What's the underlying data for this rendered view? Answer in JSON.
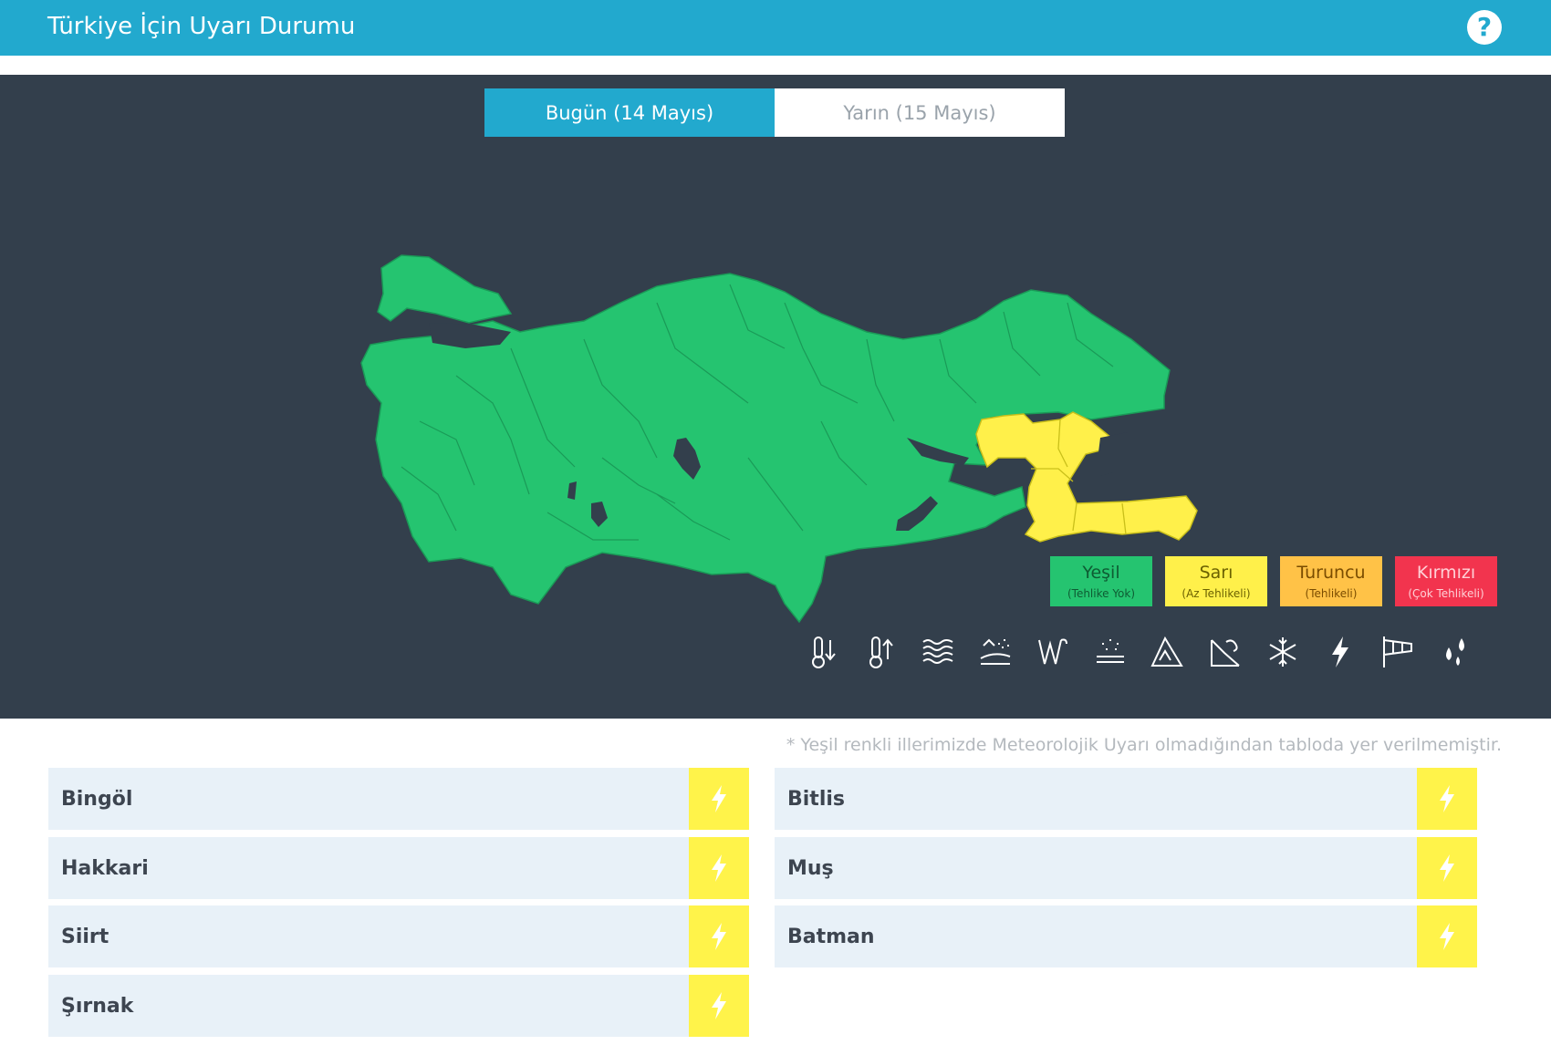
{
  "header": {
    "title": "Türkiye İçin Uyarı Durumu",
    "help_icon": "question-icon"
  },
  "tabs": [
    {
      "label": "Bugün (14 Mayıs)",
      "active": true
    },
    {
      "label": "Yarın (15 Mayıs)",
      "active": false
    }
  ],
  "map": {
    "highlighted_provinces": [
      "Bingöl",
      "Muş",
      "Bitlis",
      "Siirt",
      "Batman",
      "Şırnak",
      "Hakkari"
    ],
    "colors": {
      "normal": "#25c470",
      "warning": "#fff04a",
      "background": "#333f4c"
    }
  },
  "legend": [
    {
      "label": "Yeşil",
      "sub": "(Tehlike Yok)",
      "color": "#25c470"
    },
    {
      "label": "Sarı",
      "sub": "(Az Tehlikeli)",
      "color": "#fff04a"
    },
    {
      "label": "Turuncu",
      "sub": "(Tehlikeli)",
      "color": "#ffc247"
    },
    {
      "label": "Kırmızı",
      "sub": "(Çok Tehlikeli)",
      "color": "#f2344e"
    }
  ],
  "hazard_icons": [
    "cold-icon",
    "heat-icon",
    "fog-icon",
    "dust-icon",
    "wind-icon",
    "snowfall-icon",
    "avalanche-icon",
    "flood-icon",
    "frost-icon",
    "thunderstorm-icon",
    "windsock-icon",
    "rain-icon"
  ],
  "note": "* Yeşil renkli illerimizde Meteorolojik Uyarı olmadığından tabloda yer verilmemiştir.",
  "warnings": {
    "left": [
      {
        "name": "Bingöl",
        "hazard": "thunderstorm",
        "level_color": "#fff34a"
      },
      {
        "name": "Hakkari",
        "hazard": "thunderstorm",
        "level_color": "#fff34a"
      },
      {
        "name": "Siirt",
        "hazard": "thunderstorm",
        "level_color": "#fff34a"
      },
      {
        "name": "Şırnak",
        "hazard": "thunderstorm",
        "level_color": "#fff34a"
      }
    ],
    "right": [
      {
        "name": "Bitlis",
        "hazard": "thunderstorm",
        "level_color": "#fff34a"
      },
      {
        "name": "Muş",
        "hazard": "thunderstorm",
        "level_color": "#fff34a"
      },
      {
        "name": "Batman",
        "hazard": "thunderstorm",
        "level_color": "#fff34a"
      }
    ]
  }
}
